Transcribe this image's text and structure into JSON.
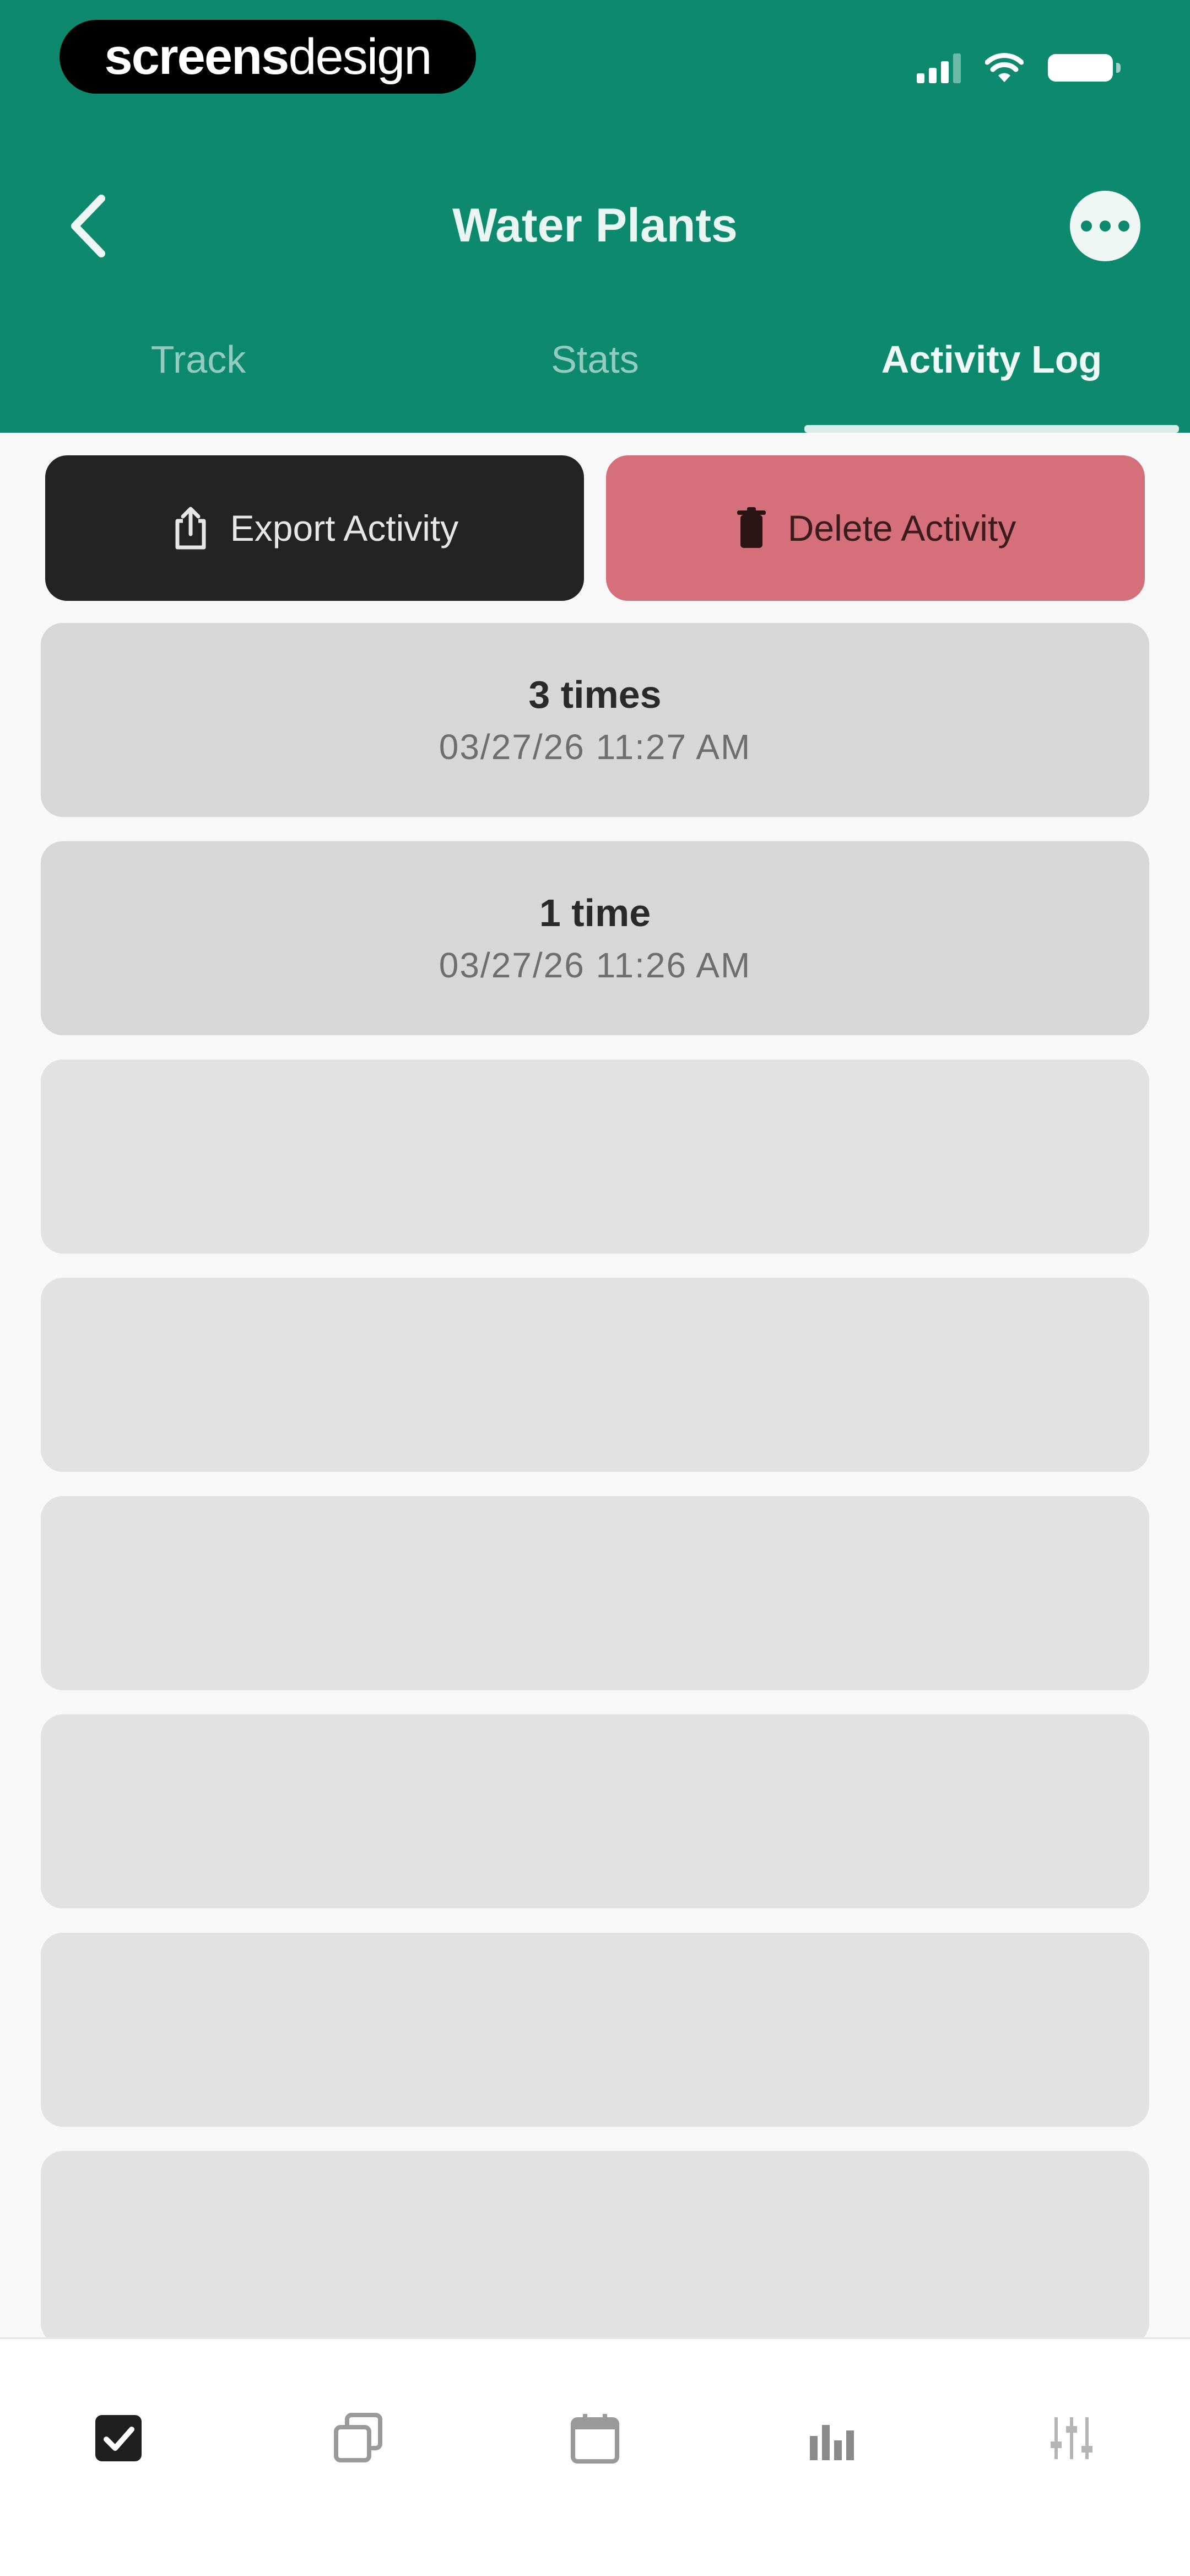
{
  "status_bar": {
    "brand_part1": "screens",
    "brand_part2": "design"
  },
  "header": {
    "title": "Water Plants",
    "back_icon": "chevron-left-icon",
    "more_icon": "ellipsis-circle-icon"
  },
  "tabs": [
    {
      "label": "Track",
      "active": false
    },
    {
      "label": "Stats",
      "active": false
    },
    {
      "label": "Activity Log",
      "active": true
    }
  ],
  "actions": {
    "export_label": "Export Activity",
    "export_icon": "share-icon",
    "delete_label": "Delete Activity",
    "delete_icon": "trash-icon"
  },
  "log": [
    {
      "count": "3 times",
      "timestamp": "03/27/26 11:27 AM"
    },
    {
      "count": "1 time",
      "timestamp": "03/27/26 11:26 AM"
    }
  ],
  "empty_slots": 6,
  "tabbar": [
    {
      "icon": "checkbox-icon",
      "active": true
    },
    {
      "icon": "copy-icon",
      "active": false
    },
    {
      "icon": "calendar-icon",
      "active": false
    },
    {
      "icon": "bar-chart-icon",
      "active": false
    },
    {
      "icon": "sliders-icon",
      "active": false
    }
  ],
  "colors": {
    "header_bg": "#0d8a6e",
    "delete_bg": "#d56f7a",
    "export_bg": "#232323"
  }
}
